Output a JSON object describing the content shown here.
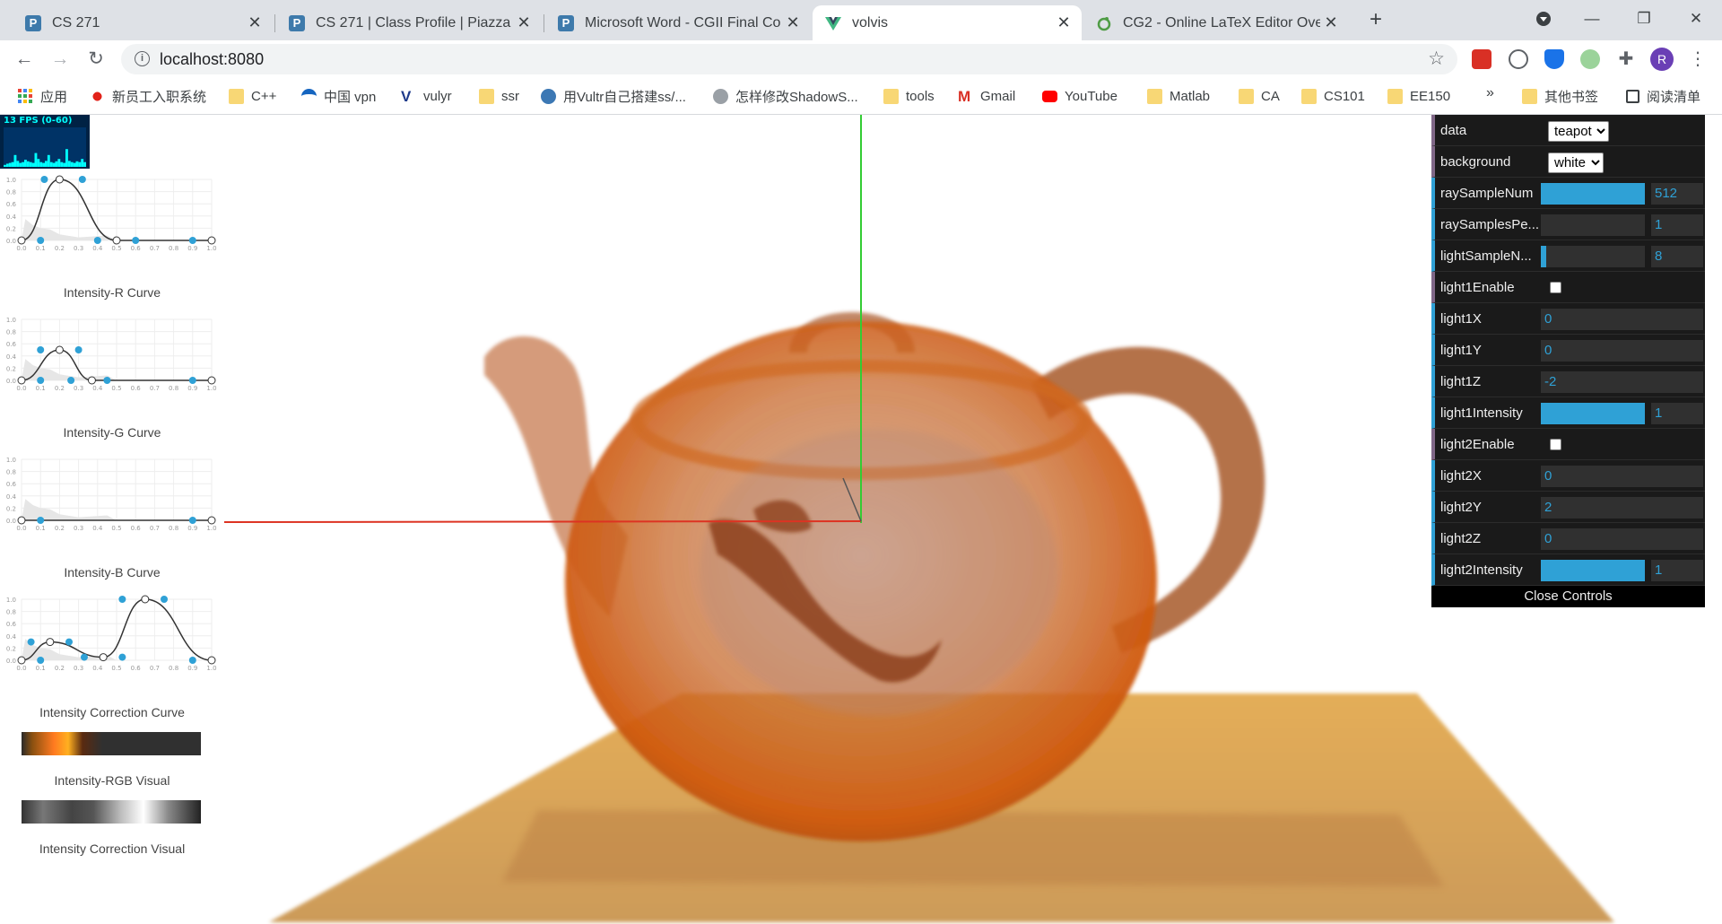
{
  "browser": {
    "tabs": [
      {
        "title": "CS 271",
        "favicon": "piazza-icon",
        "active": false
      },
      {
        "title": "CS 271 | Class Profile | Piazza",
        "favicon": "piazza-icon",
        "active": false
      },
      {
        "title": "Microsoft Word - CGII Final Co",
        "favicon": "piazza-icon",
        "active": false
      },
      {
        "title": "volvis",
        "favicon": "vue-icon",
        "active": true
      },
      {
        "title": "CG2 - Online LaTeX Editor Ove",
        "favicon": "overleaf-icon",
        "active": false
      }
    ],
    "new_tab_label": "+",
    "url": "localhost:8080",
    "avatar_letter": "R",
    "bookmarks": [
      {
        "label": "应用",
        "icon": "apps-grid-icon"
      },
      {
        "label": "新员工入职系统",
        "icon": "huawei-icon"
      },
      {
        "label": "C++",
        "icon": "folder-icon"
      },
      {
        "label": "中国 vpn",
        "icon": "vpn-icon"
      },
      {
        "label": "vulyr",
        "icon": "v-logo-icon"
      },
      {
        "label": "ssr",
        "icon": "folder-icon"
      },
      {
        "label": "用Vultr自己搭建ss/...",
        "icon": "globe-icon"
      },
      {
        "label": "怎样修改ShadowS...",
        "icon": "zhihu-icon"
      },
      {
        "label": "tools",
        "icon": "folder-icon"
      },
      {
        "label": "Gmail",
        "icon": "gmail-icon"
      },
      {
        "label": "YouTube",
        "icon": "youtube-icon"
      },
      {
        "label": "Matlab",
        "icon": "folder-icon"
      },
      {
        "label": "CA",
        "icon": "folder-icon"
      },
      {
        "label": "CS101",
        "icon": "folder-icon"
      },
      {
        "label": "EE150",
        "icon": "folder-icon"
      }
    ],
    "bookmarks_overflow": "»",
    "other_bookmarks": "其他书签",
    "reading_list": "阅读清单"
  },
  "fps": {
    "label": "13 FPS (0-60)",
    "history": [
      0.05,
      0.08,
      0.1,
      0.12,
      0.3,
      0.15,
      0.1,
      0.12,
      0.18,
      0.14,
      0.12,
      0.1,
      0.35,
      0.2,
      0.12,
      0.1,
      0.15,
      0.3,
      0.12,
      0.1,
      0.14,
      0.2,
      0.12,
      0.1,
      0.45,
      0.15,
      0.12,
      0.1,
      0.14,
      0.12,
      0.2,
      0.12
    ]
  },
  "curves": [
    {
      "label": "Intensity-R Curve",
      "ticks": [
        "0.0",
        "0.1",
        "0.2",
        "0.3",
        "0.4",
        "0.5",
        "0.6",
        "0.7",
        "0.8",
        "0.9",
        "1.0"
      ],
      "yticks": [
        "1.0",
        "0.8",
        "0.6",
        "0.4",
        "0.2",
        "0.0"
      ],
      "points": [
        [
          0,
          0
        ],
        [
          0.2,
          1
        ],
        [
          0.5,
          0
        ],
        [
          1,
          0
        ]
      ],
      "handles": [
        [
          0.1,
          0
        ],
        [
          0.12,
          1
        ],
        [
          0.32,
          1
        ],
        [
          0.4,
          0
        ],
        [
          0.6,
          0
        ],
        [
          0.9,
          0
        ]
      ]
    },
    {
      "label": "Intensity-G Curve",
      "ticks": [
        "0.0",
        "0.1",
        "0.2",
        "0.3",
        "0.4",
        "0.5",
        "0.6",
        "0.7",
        "0.8",
        "0.9",
        "1.0"
      ],
      "yticks": [
        "1.0",
        "0.8",
        "0.6",
        "0.4",
        "0.2",
        "0.0"
      ],
      "points": [
        [
          0,
          0
        ],
        [
          0.2,
          0.5
        ],
        [
          0.37,
          0
        ],
        [
          1,
          0
        ]
      ],
      "handles": [
        [
          0.1,
          0
        ],
        [
          0.1,
          0.5
        ],
        [
          0.3,
          0.5
        ],
        [
          0.26,
          0
        ],
        [
          0.45,
          0
        ],
        [
          0.9,
          0
        ]
      ]
    },
    {
      "label": "Intensity-B Curve",
      "ticks": [
        "0.0",
        "0.1",
        "0.2",
        "0.3",
        "0.4",
        "0.5",
        "0.6",
        "0.7",
        "0.8",
        "0.9",
        "1.0"
      ],
      "yticks": [
        "1.0",
        "0.8",
        "0.6",
        "0.4",
        "0.2",
        "0.0"
      ],
      "points": [
        [
          0,
          0
        ],
        [
          1,
          0
        ]
      ],
      "handles": [
        [
          0.1,
          0
        ],
        [
          0.9,
          0
        ]
      ]
    },
    {
      "label": "Intensity Correction Curve",
      "ticks": [
        "0.0",
        "0.1",
        "0.2",
        "0.3",
        "0.4",
        "0.5",
        "0.6",
        "0.7",
        "0.8",
        "0.9",
        "1.0"
      ],
      "yticks": [
        "1.0",
        "0.8",
        "0.6",
        "0.4",
        "0.2",
        "0.0"
      ],
      "points": [
        [
          0,
          0
        ],
        [
          0.15,
          0.3
        ],
        [
          0.43,
          0.05
        ],
        [
          0.65,
          1
        ],
        [
          1,
          0
        ]
      ],
      "handles": [
        [
          0.05,
          0.3
        ],
        [
          0.1,
          0
        ],
        [
          0.25,
          0.3
        ],
        [
          0.33,
          0.05
        ],
        [
          0.53,
          0.05
        ],
        [
          0.53,
          1
        ],
        [
          0.75,
          1
        ],
        [
          0.9,
          0
        ]
      ]
    }
  ],
  "visuals": [
    {
      "label": "Intensity-RGB Visual"
    },
    {
      "label": "Intensity Correction Visual"
    }
  ],
  "controls": {
    "rows": [
      {
        "label": "data",
        "kind": "select",
        "value": "teapot"
      },
      {
        "label": "background",
        "kind": "select",
        "value": "white"
      },
      {
        "label": "raySampleNum",
        "kind": "slider",
        "value": "512",
        "fraction": 1.0
      },
      {
        "label": "raySamplesPe...",
        "kind": "slider",
        "value": "1",
        "fraction": 0.0
      },
      {
        "label": "lightSampleN...",
        "kind": "slider",
        "value": "8",
        "fraction": 0.05
      },
      {
        "label": "light1Enable",
        "kind": "checkbox",
        "value": ""
      },
      {
        "label": "light1X",
        "kind": "number",
        "value": "0"
      },
      {
        "label": "light1Y",
        "kind": "number",
        "value": "0"
      },
      {
        "label": "light1Z",
        "kind": "number",
        "value": "-2"
      },
      {
        "label": "light1Intensity",
        "kind": "slider",
        "value": "1",
        "fraction": 1.0
      },
      {
        "label": "light2Enable",
        "kind": "checkbox",
        "value": ""
      },
      {
        "label": "light2X",
        "kind": "number",
        "value": "0"
      },
      {
        "label": "light2Y",
        "kind": "number",
        "value": "2"
      },
      {
        "label": "light2Z",
        "kind": "number",
        "value": "0"
      },
      {
        "label": "light2Intensity",
        "kind": "slider",
        "value": "1",
        "fraction": 1.0
      }
    ],
    "close_label": "Close Controls"
  },
  "colors": {
    "accent": "#2fa1d6",
    "teapot": "#c8621a",
    "plane": "#d9992f",
    "axis_y": "#33cc33",
    "axis_x": "#dd3322"
  }
}
